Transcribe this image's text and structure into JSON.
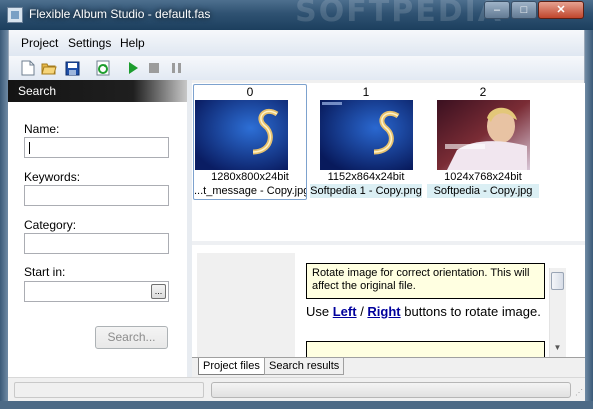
{
  "window": {
    "title": "Flexible Album Studio - default.fas",
    "watermark": "SOFTPEDIA",
    "buttons": {
      "minimize": "–",
      "maximize": "□",
      "close": "✕"
    }
  },
  "menu": {
    "project": "Project",
    "settings": "Settings",
    "help": "Help"
  },
  "toolbar": {
    "icons": [
      "new-icon",
      "open-icon",
      "save-icon",
      "refresh-icon",
      "play-icon",
      "stop-icon",
      "pause-icon"
    ],
    "colors": {
      "play": "#1d9d2e",
      "disabled": "#9c9c9c",
      "save": "#1f4fa8",
      "open": "#e6b84a"
    }
  },
  "search": {
    "header": "Search",
    "name_label": "Name:",
    "name_value": "",
    "keywords_label": "Keywords:",
    "keywords_value": "",
    "category_label": "Category:",
    "category_value": "",
    "startin_label": "Start in:",
    "startin_value": "",
    "browse_label": "...",
    "search_button": "Search..."
  },
  "thumbnails": [
    {
      "index": "0",
      "resolution": "1280x800x24bit",
      "filename": "...t_message - Copy.jpg",
      "selected": true
    },
    {
      "index": "1",
      "resolution": "1152x864x24bit",
      "filename": "Softpedia 1 - Copy.png",
      "selected": false
    },
    {
      "index": "2",
      "resolution": "1024x768x24bit",
      "filename": "Softpedia - Copy.jpg",
      "selected": false
    }
  ],
  "tips": {
    "yellow_note": "Rotate image for correct orientation.  This will affect the original file.",
    "use": "Use ",
    "left": "Left",
    "slash": " / ",
    "right": "Right",
    "rest": " buttons to rotate image."
  },
  "tabs": {
    "project_files": "Project files",
    "search_results": "Search results"
  },
  "status": {
    "grip": "⋰"
  }
}
